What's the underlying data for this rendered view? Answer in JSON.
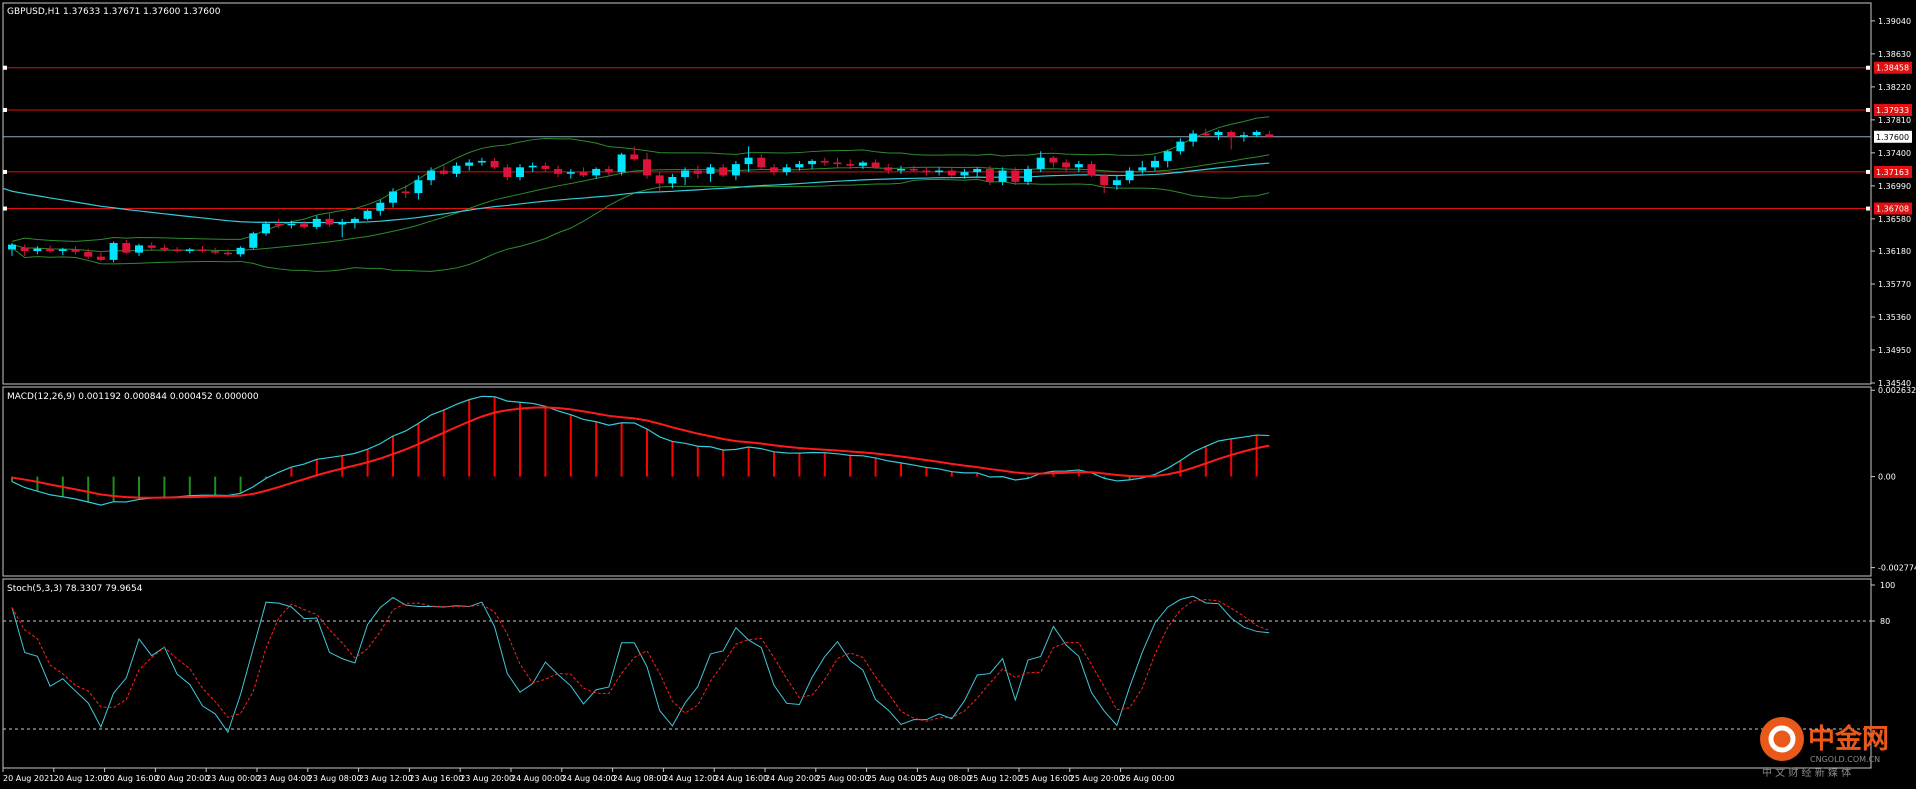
{
  "app": {
    "watermark_cn": "中金网",
    "watermark_url": "CNGOLD.COM.CN",
    "watermark_sub": "中 文 财 经 新 媒 体"
  },
  "colors": {
    "bull": "#00e5ff",
    "bear": "#dc143c",
    "bands": "#2e8b2e",
    "ma_line": "#33cbd8",
    "hline": "#e01010",
    "bid_line": "#8fa8b8",
    "macd_pos": "#ff0000",
    "macd_neg": "#1f8f1f",
    "signal": "#ff1a1a",
    "stoch_k": "#41c7d8",
    "stoch_d": "#ff2020",
    "axis_text": "#ffffff"
  },
  "chart_data": [
    {
      "type": "candlestick",
      "title": "GBPUSD,H1  1.37633 1.37671 1.37600 1.37600",
      "symbol": "GBPUSD",
      "timeframe": "H1",
      "ohlc_label": [
        1.37633,
        1.37671,
        1.376,
        1.376
      ],
      "ylim": [
        1.3454,
        1.3925
      ],
      "y_ticks": [
        "1.39040",
        "1.38630",
        "1.38220",
        "1.37810",
        "1.37400",
        "1.36990",
        "1.36580",
        "1.36180",
        "1.35770",
        "1.35360",
        "1.34950",
        "1.34540"
      ],
      "current_price": {
        "value": 1.376,
        "label": "1.37600"
      },
      "horizontal_levels": [
        {
          "value": 1.38458,
          "label": "1.38458"
        },
        {
          "value": 1.37933,
          "label": "1.37933"
        },
        {
          "value": 1.37163,
          "label": "1.37163"
        },
        {
          "value": 1.36708,
          "label": "1.36708"
        }
      ],
      "x_ticks": [
        "20 Aug 2021",
        "20 Aug 12:00",
        "20 Aug 16:00",
        "20 Aug 20:00",
        "23 Aug 00:00",
        "23 Aug 04:00",
        "23 Aug 08:00",
        "23 Aug 12:00",
        "23 Aug 16:00",
        "23 Aug 20:00",
        "24 Aug 00:00",
        "24 Aug 04:00",
        "24 Aug 08:00",
        "24 Aug 12:00",
        "24 Aug 16:00",
        "24 Aug 20:00",
        "25 Aug 00:00",
        "25 Aug 04:00",
        "25 Aug 08:00",
        "25 Aug 12:00",
        "25 Aug 16:00",
        "25 Aug 20:00",
        "26 Aug 00:00"
      ],
      "x_tick_index_step": 4,
      "candles": [
        {
          "o": 1.362,
          "h": 1.3628,
          "l": 1.3612,
          "c": 1.3626
        },
        {
          "o": 1.3622,
          "h": 1.3626,
          "l": 1.3612,
          "c": 1.3618
        },
        {
          "o": 1.3618,
          "h": 1.3624,
          "l": 1.3614,
          "c": 1.3621
        },
        {
          "o": 1.3621,
          "h": 1.3625,
          "l": 1.3616,
          "c": 1.3618
        },
        {
          "o": 1.3618,
          "h": 1.3622,
          "l": 1.3613,
          "c": 1.362
        },
        {
          "o": 1.362,
          "h": 1.3624,
          "l": 1.3614,
          "c": 1.3617
        },
        {
          "o": 1.3617,
          "h": 1.3621,
          "l": 1.3608,
          "c": 1.3611
        },
        {
          "o": 1.3611,
          "h": 1.3616,
          "l": 1.3605,
          "c": 1.3607
        },
        {
          "o": 1.3607,
          "h": 1.363,
          "l": 1.3604,
          "c": 1.3628
        },
        {
          "o": 1.3628,
          "h": 1.3632,
          "l": 1.3614,
          "c": 1.3616
        },
        {
          "o": 1.3616,
          "h": 1.3627,
          "l": 1.3612,
          "c": 1.3625
        },
        {
          "o": 1.3625,
          "h": 1.3629,
          "l": 1.3618,
          "c": 1.3622
        },
        {
          "o": 1.3622,
          "h": 1.3626,
          "l": 1.3617,
          "c": 1.362
        },
        {
          "o": 1.362,
          "h": 1.3623,
          "l": 1.3616,
          "c": 1.3618
        },
        {
          "o": 1.3618,
          "h": 1.3622,
          "l": 1.3615,
          "c": 1.362
        },
        {
          "o": 1.362,
          "h": 1.3624,
          "l": 1.3616,
          "c": 1.3618
        },
        {
          "o": 1.3618,
          "h": 1.3622,
          "l": 1.3614,
          "c": 1.3616
        },
        {
          "o": 1.3616,
          "h": 1.362,
          "l": 1.3612,
          "c": 1.3614
        },
        {
          "o": 1.3614,
          "h": 1.3624,
          "l": 1.3611,
          "c": 1.3622
        },
        {
          "o": 1.3622,
          "h": 1.3642,
          "l": 1.362,
          "c": 1.364
        },
        {
          "o": 1.364,
          "h": 1.3655,
          "l": 1.3637,
          "c": 1.3652
        },
        {
          "o": 1.3652,
          "h": 1.3658,
          "l": 1.3646,
          "c": 1.365
        },
        {
          "o": 1.365,
          "h": 1.3656,
          "l": 1.3646,
          "c": 1.3652
        },
        {
          "o": 1.3652,
          "h": 1.3656,
          "l": 1.3646,
          "c": 1.3648
        },
        {
          "o": 1.3648,
          "h": 1.3662,
          "l": 1.3645,
          "c": 1.3658
        },
        {
          "o": 1.3658,
          "h": 1.3665,
          "l": 1.3648,
          "c": 1.3651
        },
        {
          "o": 1.3651,
          "h": 1.3658,
          "l": 1.3635,
          "c": 1.3654
        },
        {
          "o": 1.3654,
          "h": 1.366,
          "l": 1.3646,
          "c": 1.3658
        },
        {
          "o": 1.3658,
          "h": 1.367,
          "l": 1.3656,
          "c": 1.3668
        },
        {
          "o": 1.3668,
          "h": 1.3682,
          "l": 1.3662,
          "c": 1.3678
        },
        {
          "o": 1.3678,
          "h": 1.3696,
          "l": 1.3672,
          "c": 1.3692
        },
        {
          "o": 1.3692,
          "h": 1.37,
          "l": 1.3684,
          "c": 1.369
        },
        {
          "o": 1.369,
          "h": 1.3712,
          "l": 1.3682,
          "c": 1.3706
        },
        {
          "o": 1.3706,
          "h": 1.3722,
          "l": 1.37,
          "c": 1.3718
        },
        {
          "o": 1.3718,
          "h": 1.3724,
          "l": 1.3712,
          "c": 1.3714
        },
        {
          "o": 1.3714,
          "h": 1.3728,
          "l": 1.371,
          "c": 1.3724
        },
        {
          "o": 1.3724,
          "h": 1.3732,
          "l": 1.3718,
          "c": 1.3728
        },
        {
          "o": 1.3728,
          "h": 1.3734,
          "l": 1.3724,
          "c": 1.373
        },
        {
          "o": 1.373,
          "h": 1.3734,
          "l": 1.372,
          "c": 1.3722
        },
        {
          "o": 1.3722,
          "h": 1.3726,
          "l": 1.3706,
          "c": 1.371
        },
        {
          "o": 1.371,
          "h": 1.3726,
          "l": 1.3706,
          "c": 1.3722
        },
        {
          "o": 1.3722,
          "h": 1.3728,
          "l": 1.3716,
          "c": 1.3724
        },
        {
          "o": 1.3724,
          "h": 1.3728,
          "l": 1.3716,
          "c": 1.372
        },
        {
          "o": 1.372,
          "h": 1.3724,
          "l": 1.371,
          "c": 1.3714
        },
        {
          "o": 1.3714,
          "h": 1.372,
          "l": 1.3708,
          "c": 1.3716
        },
        {
          "o": 1.3716,
          "h": 1.3722,
          "l": 1.371,
          "c": 1.3712
        },
        {
          "o": 1.3712,
          "h": 1.3722,
          "l": 1.3708,
          "c": 1.372
        },
        {
          "o": 1.372,
          "h": 1.3724,
          "l": 1.3712,
          "c": 1.3716
        },
        {
          "o": 1.3716,
          "h": 1.374,
          "l": 1.3712,
          "c": 1.3738
        },
        {
          "o": 1.3738,
          "h": 1.3748,
          "l": 1.373,
          "c": 1.3732
        },
        {
          "o": 1.3732,
          "h": 1.374,
          "l": 1.3708,
          "c": 1.3712
        },
        {
          "o": 1.3712,
          "h": 1.3716,
          "l": 1.369,
          "c": 1.3702
        },
        {
          "o": 1.3702,
          "h": 1.3714,
          "l": 1.3696,
          "c": 1.371
        },
        {
          "o": 1.371,
          "h": 1.3722,
          "l": 1.37,
          "c": 1.3718
        },
        {
          "o": 1.3718,
          "h": 1.3724,
          "l": 1.3708,
          "c": 1.3714
        },
        {
          "o": 1.3714,
          "h": 1.3726,
          "l": 1.3704,
          "c": 1.3722
        },
        {
          "o": 1.3722,
          "h": 1.3726,
          "l": 1.371,
          "c": 1.3712
        },
        {
          "o": 1.3712,
          "h": 1.373,
          "l": 1.3706,
          "c": 1.3726
        },
        {
          "o": 1.3726,
          "h": 1.3748,
          "l": 1.3716,
          "c": 1.3734
        },
        {
          "o": 1.3734,
          "h": 1.3738,
          "l": 1.372,
          "c": 1.3722
        },
        {
          "o": 1.3722,
          "h": 1.3726,
          "l": 1.3712,
          "c": 1.3716
        },
        {
          "o": 1.3716,
          "h": 1.3726,
          "l": 1.3712,
          "c": 1.3722
        },
        {
          "o": 1.3722,
          "h": 1.373,
          "l": 1.3718,
          "c": 1.3726
        },
        {
          "o": 1.3726,
          "h": 1.3732,
          "l": 1.372,
          "c": 1.373
        },
        {
          "o": 1.373,
          "h": 1.3734,
          "l": 1.3724,
          "c": 1.3728
        },
        {
          "o": 1.3728,
          "h": 1.3734,
          "l": 1.3722,
          "c": 1.3726
        },
        {
          "o": 1.3726,
          "h": 1.3732,
          "l": 1.372,
          "c": 1.3724
        },
        {
          "o": 1.3724,
          "h": 1.373,
          "l": 1.372,
          "c": 1.3728
        },
        {
          "o": 1.3728,
          "h": 1.3732,
          "l": 1.372,
          "c": 1.3722
        },
        {
          "o": 1.3722,
          "h": 1.3726,
          "l": 1.3714,
          "c": 1.3718
        },
        {
          "o": 1.3718,
          "h": 1.3724,
          "l": 1.3714,
          "c": 1.372
        },
        {
          "o": 1.372,
          "h": 1.3724,
          "l": 1.3716,
          "c": 1.3718
        },
        {
          "o": 1.3718,
          "h": 1.3722,
          "l": 1.3712,
          "c": 1.3716
        },
        {
          "o": 1.3716,
          "h": 1.3722,
          "l": 1.3712,
          "c": 1.3718
        },
        {
          "o": 1.3718,
          "h": 1.3722,
          "l": 1.371,
          "c": 1.3712
        },
        {
          "o": 1.3712,
          "h": 1.372,
          "l": 1.3708,
          "c": 1.3716
        },
        {
          "o": 1.3716,
          "h": 1.3722,
          "l": 1.371,
          "c": 1.372
        },
        {
          "o": 1.372,
          "h": 1.3724,
          "l": 1.37,
          "c": 1.3704
        },
        {
          "o": 1.3704,
          "h": 1.3722,
          "l": 1.37,
          "c": 1.3718
        },
        {
          "o": 1.3718,
          "h": 1.3722,
          "l": 1.37,
          "c": 1.3704
        },
        {
          "o": 1.3704,
          "h": 1.3724,
          "l": 1.37,
          "c": 1.372
        },
        {
          "o": 1.372,
          "h": 1.3742,
          "l": 1.3716,
          "c": 1.3734
        },
        {
          "o": 1.3734,
          "h": 1.3736,
          "l": 1.3722,
          "c": 1.3728
        },
        {
          "o": 1.3728,
          "h": 1.3732,
          "l": 1.3716,
          "c": 1.3722
        },
        {
          "o": 1.3722,
          "h": 1.373,
          "l": 1.3716,
          "c": 1.3726
        },
        {
          "o": 1.3726,
          "h": 1.373,
          "l": 1.371,
          "c": 1.3712
        },
        {
          "o": 1.3712,
          "h": 1.3714,
          "l": 1.369,
          "c": 1.37
        },
        {
          "o": 1.37,
          "h": 1.3712,
          "l": 1.3694,
          "c": 1.3706
        },
        {
          "o": 1.3706,
          "h": 1.3722,
          "l": 1.3702,
          "c": 1.3718
        },
        {
          "o": 1.3718,
          "h": 1.373,
          "l": 1.3714,
          "c": 1.3722
        },
        {
          "o": 1.3722,
          "h": 1.3736,
          "l": 1.3718,
          "c": 1.373
        },
        {
          "o": 1.373,
          "h": 1.3744,
          "l": 1.3722,
          "c": 1.3742
        },
        {
          "o": 1.3742,
          "h": 1.3758,
          "l": 1.3738,
          "c": 1.3754
        },
        {
          "o": 1.3754,
          "h": 1.3768,
          "l": 1.3748,
          "c": 1.3764
        },
        {
          "o": 1.3764,
          "h": 1.377,
          "l": 1.3758,
          "c": 1.3762
        },
        {
          "o": 1.3762,
          "h": 1.3768,
          "l": 1.3756,
          "c": 1.3766
        },
        {
          "o": 1.3766,
          "h": 1.3768,
          "l": 1.3744,
          "c": 1.376
        },
        {
          "o": 1.376,
          "h": 1.3766,
          "l": 1.3754,
          "c": 1.3762
        },
        {
          "o": 1.3762,
          "h": 1.3768,
          "l": 1.376,
          "c": 1.3766
        },
        {
          "o": 1.3763,
          "h": 1.3767,
          "l": 1.376,
          "c": 1.376
        }
      ],
      "indicators": {
        "bollinger": {
          "period": 20,
          "deviation": 2
        },
        "moving_average": {
          "period": 50
        }
      }
    },
    {
      "type": "macd",
      "title": "MACD(12,26,9) 0.001192 0.000844 0.000452 0.000000",
      "params": [
        12,
        26,
        9
      ],
      "ylim": [
        -0.003,
        0.0027
      ],
      "y_ticks": [
        {
          "value": 0.002632,
          "label": "0.002632"
        },
        {
          "value": 0,
          "label": "0.00"
        },
        {
          "value": -0.002774,
          "label": "-0.002774"
        }
      ]
    },
    {
      "type": "stochastic",
      "title": "Stoch(5,3,3) 78.3307 79.9654",
      "params": [
        5,
        3,
        3
      ],
      "ylim": [
        0,
        100
      ],
      "levels": [
        80,
        20
      ],
      "y_ticks": [
        {
          "value": 100,
          "label": "100"
        },
        {
          "value": 80,
          "label": "80"
        }
      ]
    }
  ]
}
